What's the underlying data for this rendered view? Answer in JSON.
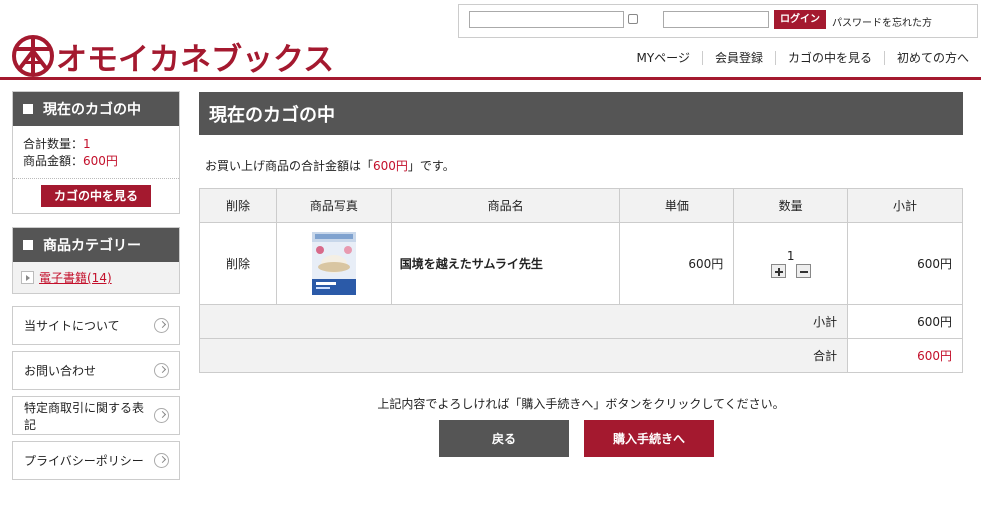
{
  "login": {
    "button_label": "ログイン",
    "forgot_password": "パスワードを忘れた方",
    "id_value": "",
    "password_value": ""
  },
  "logo": {
    "mark_glyph": "本",
    "text": "オモイカネブックス"
  },
  "topnav": [
    "MYページ",
    "会員登録",
    "カゴの中を見る",
    "初めての方へ"
  ],
  "sidebar": {
    "cart_box": {
      "title": "現在のカゴの中",
      "qty_label": "合計数量：",
      "qty_value": "1",
      "amount_label": "商品金額：",
      "amount_value": "600円",
      "view_cart_button": "カゴの中を見る"
    },
    "category_box": {
      "title": "商品カテゴリー",
      "items": [
        {
          "label": "電子書籍(14)"
        }
      ]
    },
    "links": [
      "当サイトについて",
      "お問い合わせ",
      "特定商取引に関する表記",
      "プライバシーポリシー"
    ]
  },
  "main": {
    "title": "現在のカゴの中",
    "total_msg_prefix": "お買い上げ商品の合計金額は「",
    "total_msg_amount": "600円",
    "total_msg_suffix": "」です。",
    "table": {
      "headers": [
        "削除",
        "商品写真",
        "商品名",
        "単価",
        "数量",
        "小計"
      ],
      "rows": [
        {
          "delete": "削除",
          "name": "国境を越えたサムライ先生",
          "unit_price": "600円",
          "quantity": "1",
          "subtotal": "600円"
        }
      ],
      "subtotal_label": "小計",
      "subtotal_value": "600円",
      "total_label": "合計",
      "total_value": "600円"
    },
    "confirm_msg": "上記内容でよろしければ「購入手続きへ」ボタンをクリックしてください。",
    "back_button": "戻る",
    "purchase_button": "購入手続きへ"
  },
  "colors": {
    "brand": "#a4192f",
    "header_grey": "#555555",
    "price_red": "#c3102b"
  }
}
